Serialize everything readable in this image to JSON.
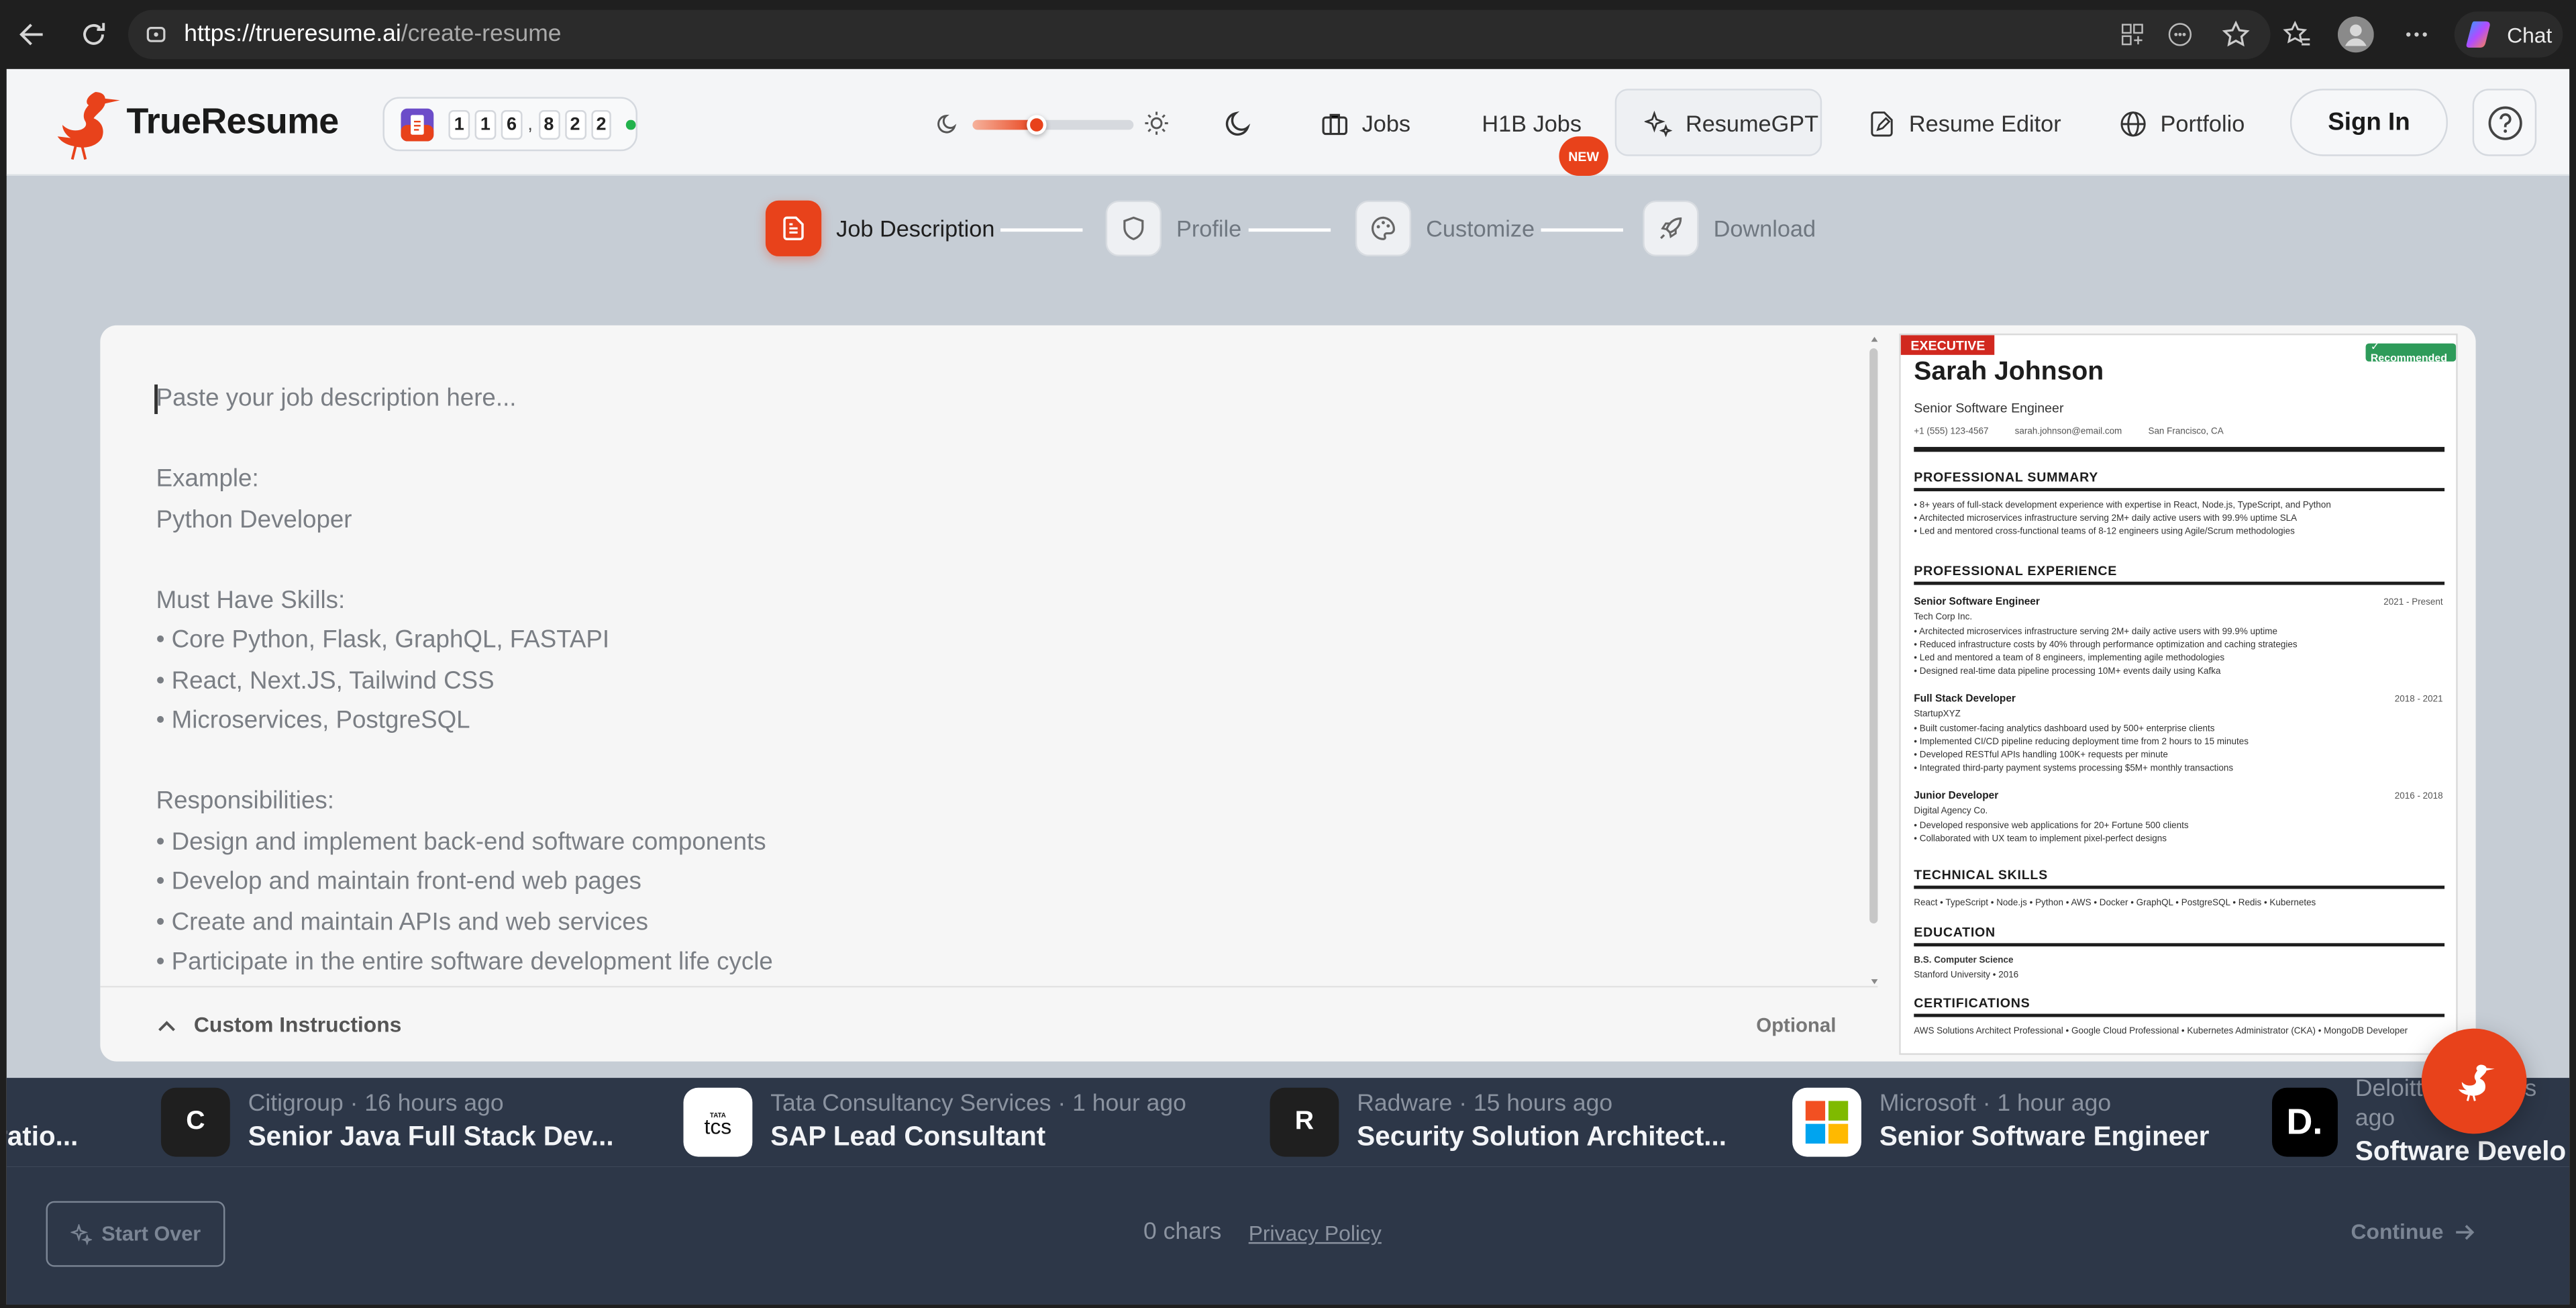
{
  "browser": {
    "url_host": "https://trueresume.ai",
    "url_path": "/create-resume",
    "chat_label": "Chat"
  },
  "nav": {
    "brand": "TrueResume",
    "counter_digits": [
      "1",
      "1",
      "6",
      ",",
      "8",
      "2",
      "2"
    ],
    "jobs": "Jobs",
    "h1b_jobs": "H1B Jobs",
    "new_badge": "NEW",
    "resumegpt": "ResumeGPT",
    "resume_editor": "Resume Editor",
    "portfolio": "Portfolio",
    "sign_in": "Sign In",
    "theme_slider_level": 0.4
  },
  "steps": [
    {
      "label": "Job Description",
      "icon": "document-icon",
      "active": true
    },
    {
      "label": "Profile",
      "icon": "shield-icon",
      "active": false
    },
    {
      "label": "Customize",
      "icon": "palette-icon",
      "active": false
    },
    {
      "label": "Download",
      "icon": "rocket-icon",
      "active": false
    }
  ],
  "editor": {
    "placeholder": "Paste your job description here...\n\nExample:\nPython Developer\n\nMust Have Skills:\n• Core Python, Flask, GraphQL, FASTAPI\n• React, Next.JS, Tailwind CSS\n• Microservices, PostgreSQL\n\nResponsibilities:\n• Design and implement back-end software components\n• Develop and maintain front-end web pages\n• Create and maintain APIs and web services\n• Participate in the entire software development life cycle",
    "custom_instructions": "Custom Instructions",
    "optional": "Optional"
  },
  "resume": {
    "badge_executive": "EXECUTIVE",
    "badge_recommended": "✓ Recommended",
    "name": "Sarah Johnson",
    "title": "Senior Software Engineer",
    "phone": "+1 (555) 123-4567",
    "email": "sarah.johnson@email.com",
    "location": "San Francisco, CA",
    "summary_heading": "PROFESSIONAL SUMMARY",
    "summary": "• 8+ years of full-stack development experience with expertise in React, Node.js, TypeScript, and Python\n• Architected microservices infrastructure serving 2M+ daily active users with 99.9% uptime SLA\n• Led and mentored cross-functional teams of 8-12 engineers using Agile/Scrum methodologies",
    "experience_heading": "PROFESSIONAL EXPERIENCE",
    "jobs": [
      {
        "role": "Senior Software Engineer",
        "dates": "2021 - Present",
        "company": "Tech Corp Inc.",
        "bullets": "• Architected microservices infrastructure serving 2M+ daily active users with 99.9% uptime\n• Reduced infrastructure costs by 40% through performance optimization and caching strategies\n• Led and mentored a team of 8 engineers, implementing agile methodologies\n• Designed real-time data pipeline processing 10M+ events daily using Kafka"
      },
      {
        "role": "Full Stack Developer",
        "dates": "2018 - 2021",
        "company": "StartupXYZ",
        "bullets": "• Built customer-facing analytics dashboard used by 500+ enterprise clients\n• Implemented CI/CD pipeline reducing deployment time from 2 hours to 15 minutes\n• Developed RESTful APIs handling 100K+ requests per minute\n• Integrated third-party payment systems processing $5M+ monthly transactions"
      },
      {
        "role": "Junior Developer",
        "dates": "2016 - 2018",
        "company": "Digital Agency Co.",
        "bullets": "• Developed responsive web applications for 20+ Fortune 500 clients\n• Collaborated with UX team to implement pixel-perfect designs"
      }
    ],
    "skills_heading": "TECHNICAL SKILLS",
    "skills": "React • TypeScript • Node.js • Python • AWS • Docker • GraphQL • PostgreSQL • Redis • Kubernetes",
    "education_heading": "EDUCATION",
    "degree": "B.S. Computer Science",
    "school": "Stanford University • 2016",
    "certifications_heading": "CERTIFICATIONS",
    "certifications": "AWS Solutions Architect Professional • Google Cloud Professional • Kubernetes Administrator (CKA) • MongoDB Developer"
  },
  "ticker": [
    {
      "logo": "",
      "meta": "",
      "title": "ratio..."
    },
    {
      "logo": "C",
      "meta": "Citigroup · 16 hours ago",
      "title": "Senior Java Full Stack Dev..."
    },
    {
      "logo": "tcs",
      "meta": "Tata Consultancy Services · 1 hour ago",
      "title": "SAP Lead Consultant"
    },
    {
      "logo": "R",
      "meta": "Radware · 15 hours ago",
      "title": "Security Solution Architect..."
    },
    {
      "logo": "ms",
      "meta": "Microsoft · 1 hour ago",
      "title": "Senior Software Engineer"
    },
    {
      "logo": "D.",
      "meta": "Deloitte · 1 hours ago",
      "title": "Software Develo"
    }
  ],
  "footer": {
    "start_over": "Start Over",
    "chars": "0 chars",
    "privacy": "Privacy Policy",
    "continue": "Continue"
  },
  "colors": {
    "accent": "#e8421b",
    "footer_bg": "#2d3748",
    "page_bg": "#c6cdd5"
  }
}
